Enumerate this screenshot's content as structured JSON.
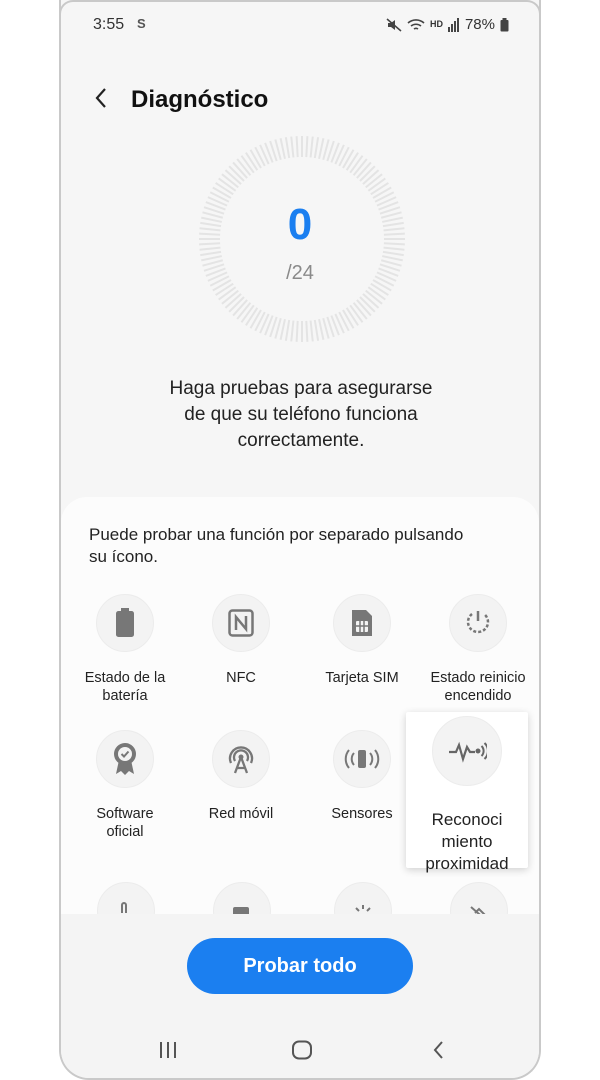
{
  "status_bar": {
    "time": "3:55",
    "s_indicator": "S",
    "battery": "78%",
    "icons": [
      "mute-icon",
      "wifi-icon",
      "hd-voice-icon",
      "signal-icon",
      "battery-icon"
    ],
    "hd_label": "HD"
  },
  "header": {
    "title": "Diagnóstico",
    "back_icon": "back-arrow-icon"
  },
  "score": {
    "value": "0",
    "total": "/24"
  },
  "intro_lines": [
    "Haga pruebas para asegurarse",
    "de que su teléfono funciona",
    "correctamente."
  ],
  "card": {
    "hint_lines": [
      "Puede probar una función por separado pulsando",
      "su ícono."
    ],
    "tiles": [
      {
        "name": "battery",
        "icon": "battery-icon",
        "label_lines": [
          "Estado de la",
          "batería"
        ]
      },
      {
        "name": "nfc",
        "icon": "nfc-icon",
        "label_lines": [
          "NFC"
        ]
      },
      {
        "name": "sim",
        "icon": "sim-card-icon",
        "label_lines": [
          "Tarjeta SIM"
        ]
      },
      {
        "name": "restart",
        "icon": "power-restart-icon",
        "label_lines": [
          "Estado reinicio",
          "encendido"
        ]
      },
      {
        "name": "software",
        "icon": "certificate-icon",
        "label_lines": [
          "Software",
          "oficial"
        ]
      },
      {
        "name": "mobile-network",
        "icon": "antenna-icon",
        "label_lines": [
          "Red móvil"
        ]
      },
      {
        "name": "sensors",
        "icon": "sensors-icon",
        "label_lines": [
          "Sensores"
        ]
      },
      {
        "name": "proximity",
        "icon": "proximity-icon",
        "label_lines": [
          "Reconoci",
          "miento",
          "proximidad"
        ]
      }
    ]
  },
  "actions": {
    "test_all": "Probar todo"
  },
  "nav": {
    "recents": "recents-icon",
    "home": "home-icon",
    "back": "back-icon"
  },
  "colors": {
    "accent": "#1b7ff0",
    "background": "#f6f6f6",
    "card": "#fcfcfc"
  }
}
